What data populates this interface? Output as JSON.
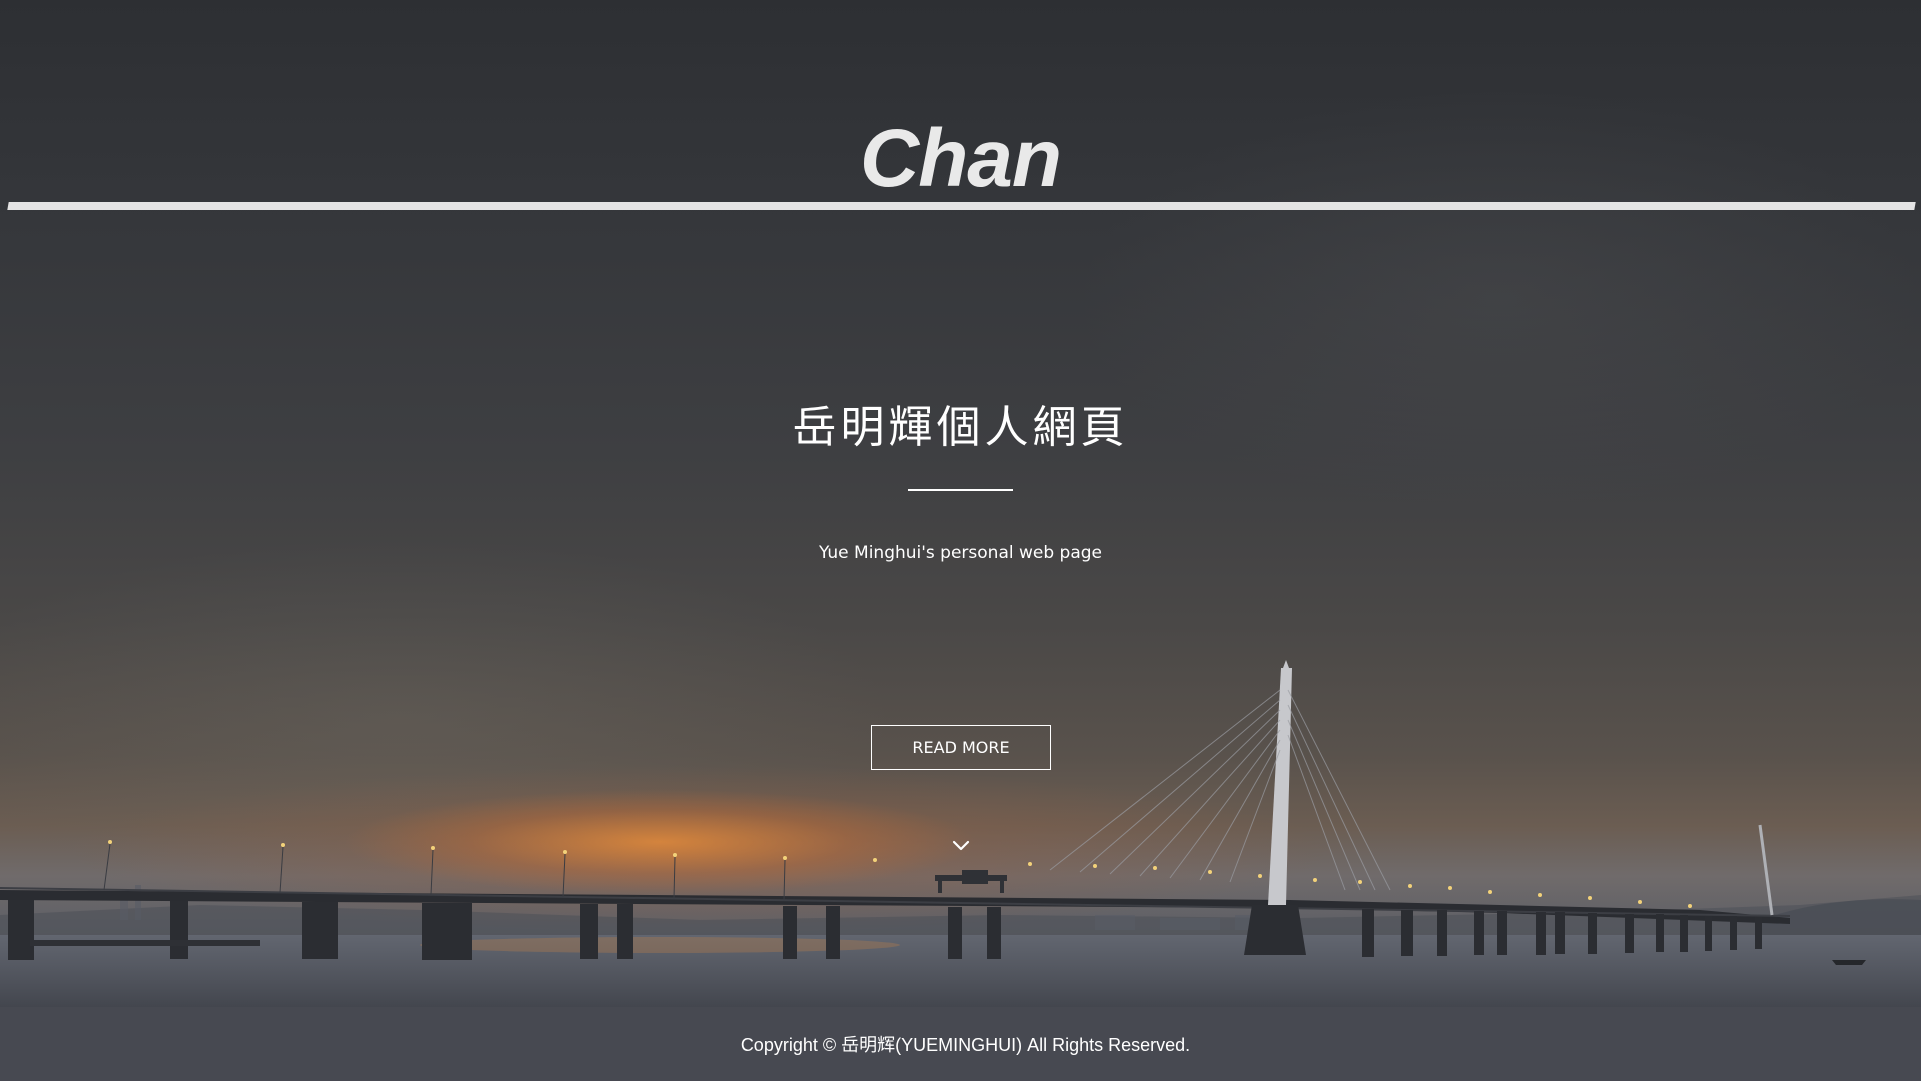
{
  "logo": {
    "text": "Chan"
  },
  "hero": {
    "title": "岳明輝個人網頁",
    "subtitle": "Yue Minghui's personal web page",
    "cta_label": "READ MORE",
    "scroll_icon": "chevron-down-icon",
    "background": "cloudy sky over sea bridge at dusk"
  },
  "footer": {
    "copyright": "Copyright © 岳明辉(YUEMINGHUI) All Rights Reserved."
  },
  "colors": {
    "text": "#ffffff",
    "footer_bg": "#474951",
    "sunset_glow": "#e28a3a"
  }
}
